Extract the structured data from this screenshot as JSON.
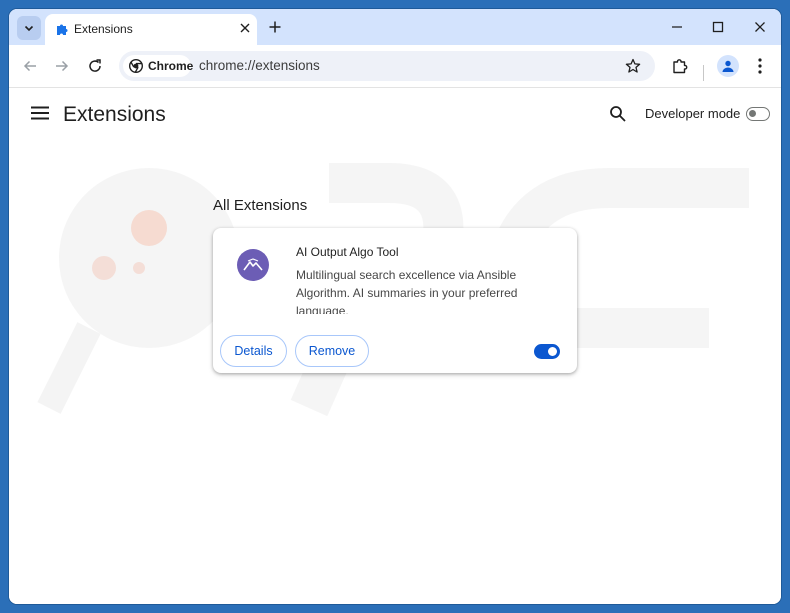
{
  "browser": {
    "tab_title": "Extensions",
    "chip_label": "Chrome",
    "url": "chrome://extensions",
    "accent": "#0b57d0",
    "frame_color": "#d3e3fd"
  },
  "page": {
    "title": "Extensions",
    "developer_mode_label": "Developer mode",
    "developer_mode_on": false,
    "section_title": "All Extensions"
  },
  "extension": {
    "name": "AI Output Algo Tool",
    "description": "Multilingual search excellence via Ansible Algorithm. AI summaries in your preferred language.",
    "details_label": "Details",
    "remove_label": "Remove",
    "enabled": true,
    "icon": "mountain-icon",
    "icon_color": "#6c5db5"
  }
}
